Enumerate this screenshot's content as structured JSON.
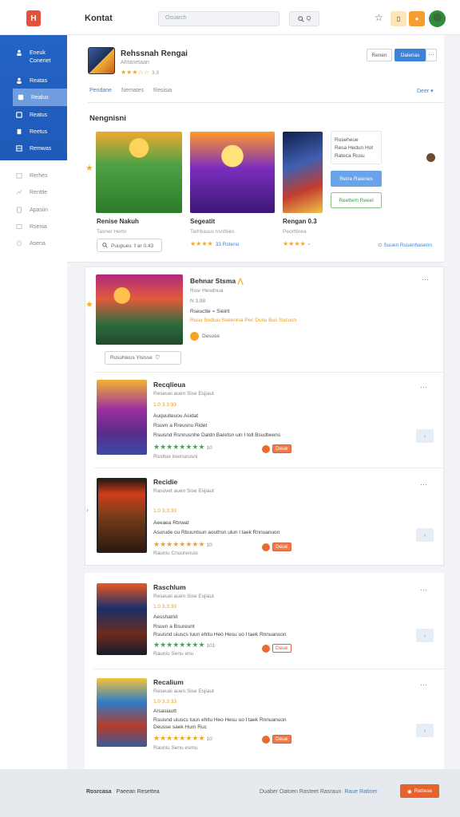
{
  "topbar": {
    "logo_text": "H",
    "title": "Kontat",
    "search_placeholder": "Osuarch",
    "search_button": "Q"
  },
  "sidebar": {
    "first_lines": [
      "Eneuk",
      "Conenet"
    ],
    "items": [
      {
        "label": "Reatas",
        "active": false
      },
      {
        "label": "Realus",
        "active": true
      },
      {
        "label": "Reatus",
        "active": false
      },
      {
        "label": "Reetus",
        "active": false
      },
      {
        "label": "Remwas",
        "active": false
      }
    ],
    "light_items": [
      "Rerhes",
      "Renttle",
      "Apasiin",
      "Rsenia",
      "Asena"
    ]
  },
  "header": {
    "name": "Rehssnah Rengai",
    "subtitle": "Ahtanetaan",
    "stars": "★★★☆☆",
    "stars_meta": "3.3",
    "btn_outline": "Renen",
    "btn_primary": "Dalenas",
    "btn_more": "⋯"
  },
  "tabs": [
    "Pendane",
    "Nemates",
    "Resisia"
  ],
  "tab_right": "Deer ▾",
  "section_title": "Nengnisni",
  "featured": [
    {
      "title": "Renise Nakuh",
      "sub": "Tasner Hertn",
      "stars": "★★★★",
      "meta": "",
      "pill": "Puupues  ⇧ar  0.43"
    },
    {
      "title": "Segeatit",
      "sub": "Tarhbasus nsnttiies",
      "stars": "★★★★",
      "meta": "33 Rstenu",
      "pill": ""
    },
    {
      "title": "Rengan 0.3",
      "sub": "Peorttinea",
      "stars": "★★★★",
      "meta": "",
      "pill": ""
    }
  ],
  "info_box": [
    "Ruseheue",
    "Resa Hedun Hot",
    "Rateca Rusu"
  ],
  "info_blue": "Retre Raienes",
  "info_green": "Reettem Reeel",
  "link_right": "Suuen Rusenhasenn",
  "list_items": [
    {
      "title": "Behnar Stsma",
      "sub": "Rssr Hesdnua",
      "rating": "N 3.98",
      "line3": "Rseuctte ⌁ Sieirlt",
      "orange": "Ruuu Sodiuu Sseenina Pec Dusu Bus Sucucn",
      "author": "Desuse",
      "pill": "Rusuhieus  Yisisse"
    },
    {
      "title": "Recqlieua",
      "sub": "Reseuei auen Sise Esjiaut",
      "rating": "1.0 3.3:93",
      "body1": "Auquuiteuou Asidat",
      "body2": "Rsuvn a Rreusnu Ridet",
      "body3": "Rsuisnd Rsnnusnhe Daldn Baretsn uin I toll Bsudtwens",
      "stars": "★★★★★★★★",
      "meta": "10",
      "foot": "Rssttue iloenurusni",
      "tag": "Deue"
    },
    {
      "title": "Recidie",
      "sub": "Rasuvet auen Sise Esjiaut",
      "rating": "1.0 3:3:33",
      "body1": "Aeeaea Rtnwat",
      "body2": "Asurude ou Rbuuntsun aouthsn ulun l taek Rnnuanuon",
      "stars": "★★★★★★★★",
      "meta": "10",
      "foot": "Rauniu Cnuurenusi",
      "tag": "Deue"
    },
    {
      "title": "Raschlum",
      "sub": "Reseuei auen Sise Esjiaut",
      "rating": "1.0 3.3:33",
      "body1": "Aesshatnit",
      "body2": "Rsuvn a Bsureunt",
      "body3": "Rsuisnd uiuscs tuun ehitu Heo Hesu uo l taek Rnnuanuon",
      "stars": "★★★★★★★★",
      "meta": "101",
      "foot": "Rauniu Senu enu",
      "tag": "Deue"
    },
    {
      "title": "Recalium",
      "sub": "Reseuei auen Sise Esjiaut",
      "rating": "1.0 3.3:33",
      "body1": "Arsasiautt",
      "body2": "Rsuisnd uiuscs tuun ehitu Heo Hesu uo l taek Rnnuanuon",
      "body3": "Deusse saek Hurn Ruc",
      "stars": "★★★★★★★★",
      "meta": "10",
      "foot": "Rauniu Senu esmu",
      "tag": "Deue"
    }
  ],
  "footer": {
    "left_bold": "Rosrcasa",
    "left": "Paeean Resettea",
    "right": "Duaber Oatoen Rasteet Rasraun",
    "right_link": "Raue Ratiner",
    "button": "Rettese"
  },
  "colors": {
    "brand_blue": "#2364c4",
    "accent_orange": "#e8632c",
    "star_gold": "#f2a623",
    "star_green": "#3fae48"
  }
}
